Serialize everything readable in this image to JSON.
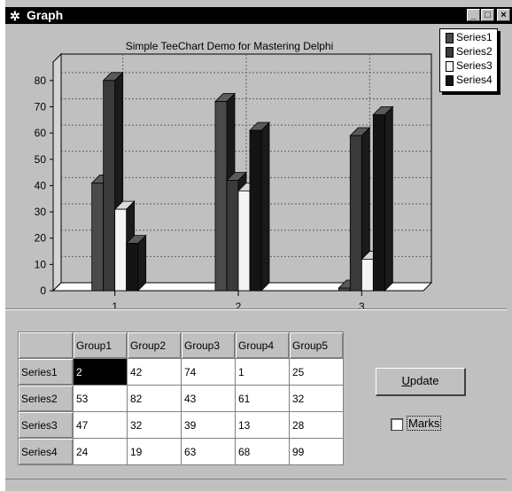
{
  "window": {
    "title": "Graph",
    "minimize": "_",
    "maximize": "□",
    "close": "×",
    "icon": "app-icon"
  },
  "chart_data": {
    "type": "bar",
    "title": "Simple TeeChart Demo for Mastering Delphi",
    "categories": [
      "1",
      "2",
      "3"
    ],
    "ylim": [
      0,
      85
    ],
    "yticks": [
      0,
      10,
      20,
      30,
      40,
      50,
      60,
      70,
      80
    ],
    "grid": true,
    "view3d": true,
    "legend_position": "top-right",
    "series": [
      {
        "name": "Series1",
        "values": [
          41,
          72,
          1
        ],
        "color": "#4a4a4a"
      },
      {
        "name": "Series2",
        "values": [
          80,
          42,
          59
        ],
        "color": "#3a3a3a"
      },
      {
        "name": "Series3",
        "values": [
          31,
          38,
          12
        ],
        "color": "#f4f4f4"
      },
      {
        "name": "Series4",
        "values": [
          18,
          61,
          67
        ],
        "color": "#141414"
      }
    ]
  },
  "legend": [
    {
      "label": "Series1",
      "color": "#4a4a4a"
    },
    {
      "label": "Series2",
      "color": "#3a3a3a"
    },
    {
      "label": "Series3",
      "color": "#f4f4f4"
    },
    {
      "label": "Series4",
      "color": "#141414"
    }
  ],
  "grid": {
    "columns": [
      "Group1",
      "Group2",
      "Group3",
      "Group4",
      "Group5"
    ],
    "rows": [
      {
        "label": "Series1",
        "values": [
          "2",
          "42",
          "74",
          "1",
          "25"
        ]
      },
      {
        "label": "Series2",
        "values": [
          "53",
          "82",
          "43",
          "61",
          "32"
        ]
      },
      {
        "label": "Series3",
        "values": [
          "47",
          "32",
          "39",
          "13",
          "28"
        ]
      },
      {
        "label": "Series4",
        "values": [
          "24",
          "19",
          "63",
          "68",
          "99"
        ]
      }
    ]
  },
  "update_button": {
    "label_u": "U",
    "label_rest": "pdate"
  },
  "marks": {
    "label": "Marks",
    "checked": false
  }
}
